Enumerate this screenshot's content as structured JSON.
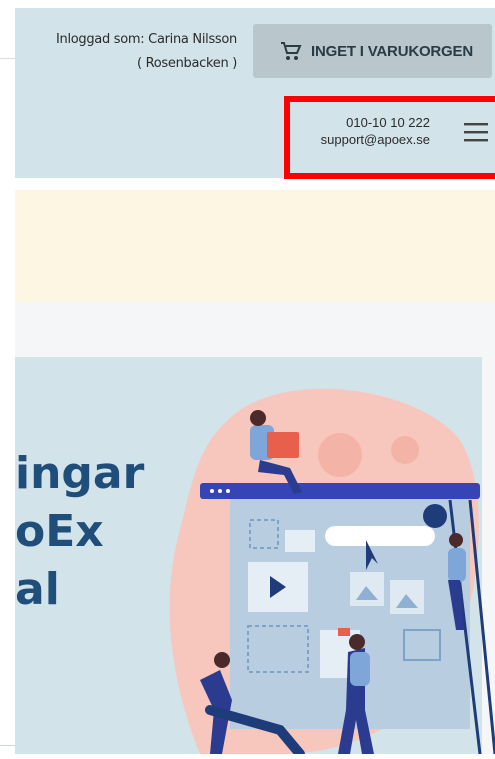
{
  "header": {
    "login_label": "Inloggad som: Carina Nilsson",
    "login_org": "( Rosenbacken )",
    "cart_label": "INGET I VARUKORGEN",
    "cart_icon": "shopping-cart-icon"
  },
  "contact": {
    "phone": "010-10 10 222",
    "email": "support@apoex.se",
    "menu_icon": "hamburger-menu-icon"
  },
  "hero": {
    "title_lines": [
      "ingar",
      "oEx",
      "al"
    ]
  },
  "colors": {
    "header_bg": "#d3e3ea",
    "cart_btn": "#b9c7cd",
    "highlight": "#ff0000",
    "banner_bg": "#fdf6e3",
    "hero_title": "#1f4e7a"
  }
}
